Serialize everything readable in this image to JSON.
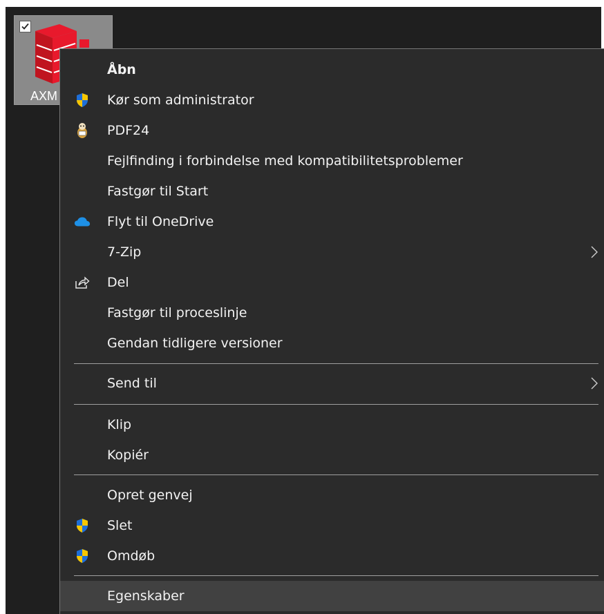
{
  "file": {
    "label": "AXM"
  },
  "menu": {
    "items": [
      {
        "label": "Åbn",
        "icon": null,
        "bold": true
      },
      {
        "label": "Kør som administrator",
        "icon": "uac-shield-icon"
      },
      {
        "label": "PDF24",
        "icon": "pdf24-icon"
      },
      {
        "label": "Fejlfinding i forbindelse med kompatibilitetsproblemer",
        "icon": null
      },
      {
        "label": "Fastgør til Start",
        "icon": null
      },
      {
        "label": "Flyt til OneDrive",
        "icon": "onedrive-cloud-icon"
      },
      {
        "label": "7-Zip",
        "icon": null,
        "submenu": true
      },
      {
        "label": "Del",
        "icon": "share-icon"
      },
      {
        "label": "Fastgør til proceslinje",
        "icon": null
      },
      {
        "label": "Gendan tidligere versioner",
        "icon": null
      },
      {
        "label": "Send til",
        "icon": null,
        "submenu": true
      },
      {
        "label": "Klip",
        "icon": null
      },
      {
        "label": "Kopiér",
        "icon": null
      },
      {
        "label": "Opret genvej",
        "icon": null
      },
      {
        "label": "Slet",
        "icon": "uac-shield-icon"
      },
      {
        "label": "Omdøb",
        "icon": "uac-shield-icon"
      },
      {
        "label": "Egenskaber",
        "icon": null,
        "highlighted": true
      }
    ]
  },
  "colors": {
    "menu_background": "#2b2b2b",
    "desktop_background": "#1f1f1f",
    "highlight": "#414141",
    "text": "#f2f2f2",
    "shield_blue": "#1e6fd9",
    "shield_yellow": "#f7c600",
    "onedrive_blue": "#1e90e6"
  }
}
